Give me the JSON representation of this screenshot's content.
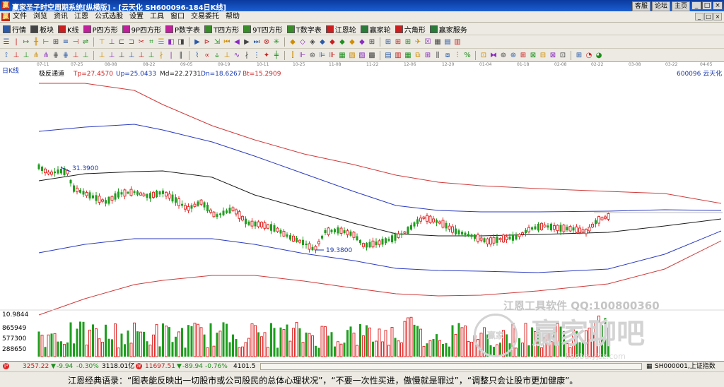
{
  "window": {
    "app_icon": "赢",
    "title": "赢家圣子时空周期系统[纵横版] - [云天化  SH600096-184日K线]",
    "links": [
      "客服",
      "论坛",
      "主页"
    ],
    "controls": [
      "_",
      "□",
      "×"
    ]
  },
  "menu": {
    "icon": "赢",
    "items": [
      "文件",
      "浏览",
      "资讯",
      "江恩",
      "公式选股",
      "设置",
      "工具",
      "窗口",
      "交易委托",
      "帮助"
    ],
    "window_controls": [
      "_",
      "□",
      "×"
    ]
  },
  "toolbar1": {
    "items": [
      {
        "icon": "table-icon",
        "label": "行情",
        "color": "#2b5aa8"
      },
      {
        "icon": "grid-icon",
        "label": "板块",
        "color": "#444444"
      },
      {
        "icon": "candle-icon",
        "label": "K线",
        "color": "#c82020"
      },
      {
        "icon": "p-box-icon",
        "label": "P四方形",
        "color": "#c0209a"
      },
      {
        "icon": "9p-box-icon",
        "label": "9P四方形",
        "color": "#c0209a"
      },
      {
        "icon": "p-number-icon",
        "label": "P数字表",
        "color": "#c0209a"
      },
      {
        "icon": "t-box-icon",
        "label": "T四方形",
        "color": "#3a8c2a"
      },
      {
        "icon": "9t-box-icon",
        "label": "9T四方形",
        "color": "#3a8c2a"
      },
      {
        "icon": "t-number-icon",
        "label": "T数字表",
        "color": "#3a8c2a"
      },
      {
        "icon": "gann-wheel-icon",
        "label": "江恩轮",
        "color": "#c82020"
      },
      {
        "icon": "winner-wheel-icon",
        "label": "赢家轮",
        "color": "#2a7a3a"
      },
      {
        "icon": "hexagon-icon",
        "label": "六角形",
        "color": "#c82020"
      },
      {
        "icon": "service-icon",
        "label": "赢家服务",
        "color": "#2a7a3a"
      }
    ]
  },
  "date_axis": [
    "07-11",
    "07-25",
    "08-08",
    "08-22",
    "09-05",
    "09-19",
    "10-11",
    "10-25",
    "11-08",
    "11-22",
    "12-06",
    "12-20",
    "01-04",
    "01-18",
    "02-08",
    "02-22",
    "03-08",
    "03-22",
    "04-05"
  ],
  "chart": {
    "period_label": "日K线",
    "indicator": {
      "name": "极反通道",
      "tp": "Tp=27.4570",
      "up": "Up=25.0433",
      "md": "Md=22.2731",
      "dn": "Dn=18.6267",
      "bt": "Bt=15.2909"
    },
    "stock_label": "600096  云天化",
    "high_marker": "31.3900",
    "low_marker": "19.3800",
    "colors": {
      "up_candle": "#e03030",
      "down_candle": "#1e9e1e",
      "outer_band": "#d03a3a",
      "inner_band": "#2a3ac0",
      "mid_line": "#1a1a1a",
      "indicator_blue": "#1a3ab0",
      "indicator_red": "#d02020"
    }
  },
  "volume": {
    "scale_labels": [
      "10.9844",
      "865949",
      "577300",
      "288650"
    ]
  },
  "watermark": {
    "line1": "江恩工具软件  QQ:100800360",
    "badge": "赢家",
    "text": "赢家聊吧",
    "url": "liaoba.yjsz.com"
  },
  "status": {
    "sh_index": "3257.22",
    "sh_change": "-9.94",
    "sh_pct": "-0.30%",
    "sh_amount": "3118.01亿",
    "sz_index": "11697.51",
    "sz_change": "-89.94",
    "sz_pct": "-0.76%",
    "sz_amount": "4101.5",
    "symbol_box": "SH000001,上证指数"
  },
  "quote": "江恩经典语录：“图表能反映出一切股市或公司股民的总体心理状况”，“不要一次性买进，傲慢就是罪过”，“调整只会让股市更加健康”。"
}
